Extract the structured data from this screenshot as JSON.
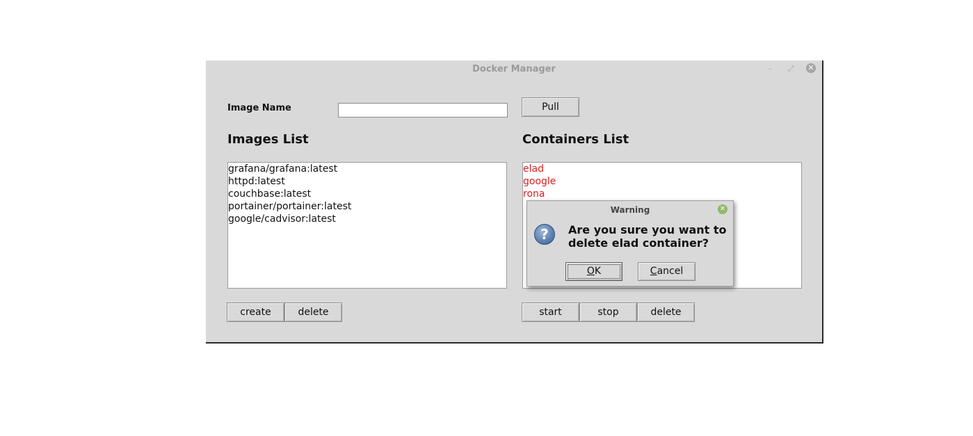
{
  "window": {
    "title": "Docker Manager",
    "controls": {
      "minimize": "–",
      "maximize": "⤢",
      "close": "✕"
    }
  },
  "form": {
    "image_name_label": "Image Name",
    "image_name_value": "",
    "pull_label": "Pull"
  },
  "images": {
    "title": "Images List",
    "items": [
      "grafana/grafana:latest",
      "httpd:latest",
      "couchbase:latest",
      "portainer/portainer:latest",
      "google/cadvisor:latest"
    ],
    "create_label": "create",
    "delete_label": "delete"
  },
  "containers": {
    "title": "Containers List",
    "items": [
      "elad",
      "google",
      "rona"
    ],
    "item_color": "#e01b1b",
    "start_label": "start",
    "stop_label": "stop",
    "delete_label": "delete"
  },
  "dialog": {
    "title": "Warning",
    "icon": "question-icon",
    "message": "Are you sure you want to delete elad container?",
    "ok_mnemonic": "O",
    "ok_rest": "K",
    "cancel_mnemonic": "C",
    "cancel_rest": "ancel"
  }
}
